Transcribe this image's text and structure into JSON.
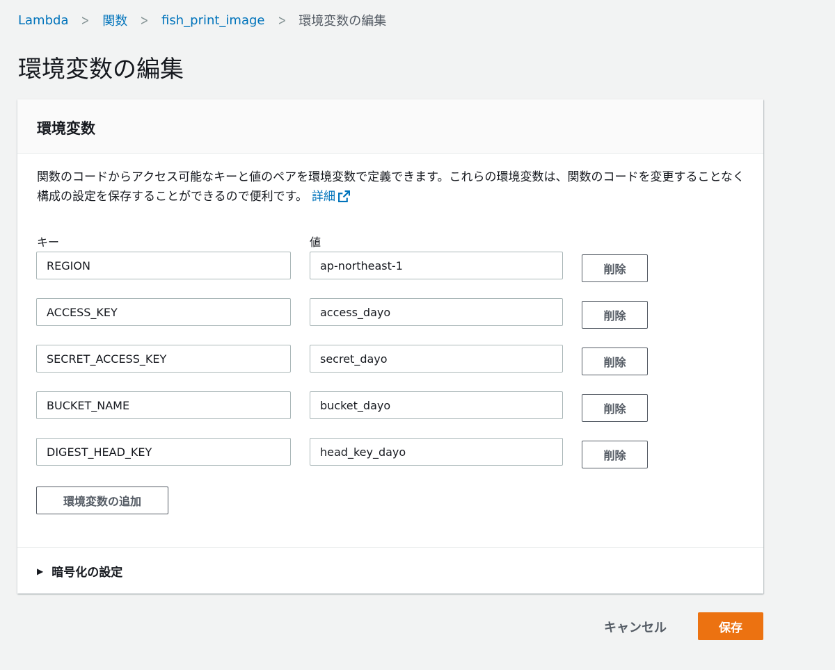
{
  "breadcrumb": {
    "items": [
      "Lambda",
      "関数",
      "fish_print_image"
    ],
    "current": "環境変数の編集",
    "separator": ">"
  },
  "page": {
    "title": "環境変数の編集"
  },
  "panel": {
    "title": "環境変数",
    "description": "関数のコードからアクセス可能なキーと値のペアを環境変数で定義できます。これらの環境変数は、関数のコードを変更することなく構成の設定を保存することができるので便利です。",
    "learn_more": "詳細",
    "key_label": "キー",
    "value_label": "値",
    "rows": [
      {
        "key": "REGION",
        "value": "ap-northeast-1",
        "delete_label": "削除"
      },
      {
        "key": "ACCESS_KEY",
        "value": "access_dayo",
        "delete_label": "削除"
      },
      {
        "key": "SECRET_ACCESS_KEY",
        "value": "secret_dayo",
        "delete_label": "削除"
      },
      {
        "key": "BUCKET_NAME",
        "value": "bucket_dayo",
        "delete_label": "削除"
      },
      {
        "key": "DIGEST_HEAD_KEY",
        "value": "head_key_dayo",
        "delete_label": "削除"
      }
    ],
    "add_label": "環境変数の追加",
    "encryption_label": "暗号化の設定"
  },
  "footer": {
    "cancel_label": "キャンセル",
    "save_label": "保存"
  },
  "colors": {
    "link": "#0073bb",
    "primary": "#ec7211",
    "background": "#f2f3f3"
  },
  "icons": {
    "breadcrumb_sep": "chevron-right-icon",
    "learn_more": "external-link-icon",
    "expander": "caret-right-icon"
  }
}
